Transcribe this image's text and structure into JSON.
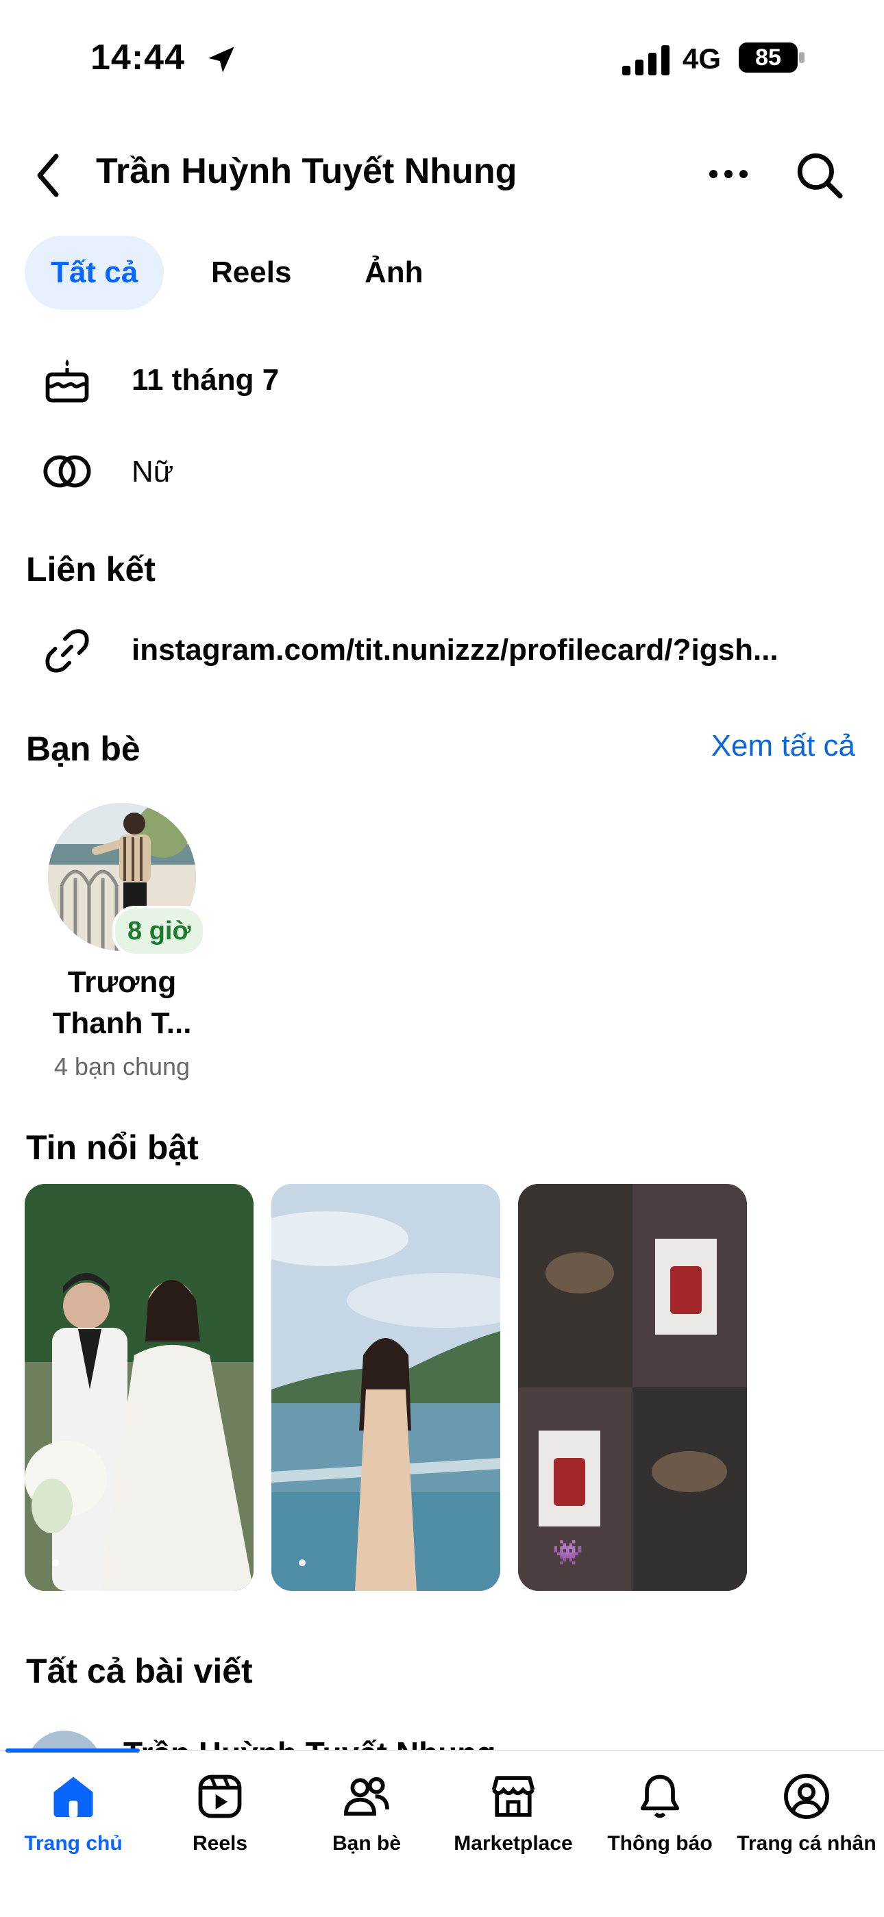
{
  "status": {
    "time": "14:44",
    "network": "4G",
    "battery": "85"
  },
  "header": {
    "title": "Trần Huỳnh Tuyết Nhung",
    "back_icon": "chevron-left-icon",
    "more_icon": "ellipsis-icon",
    "search_icon": "search-icon"
  },
  "tabs": [
    {
      "label": "Tất cả",
      "active": true
    },
    {
      "label": "Reels",
      "active": false
    },
    {
      "label": "Ảnh",
      "active": false
    }
  ],
  "info": {
    "birthday": "11 tháng 7",
    "gender": "Nữ"
  },
  "links": {
    "title": "Liên kết",
    "url": "instagram.com/tit.nunizzz/profilecard/?igsh..."
  },
  "friends": {
    "title": "Bạn bè",
    "see_all": "Xem tất cả",
    "items": [
      {
        "name_line1": "Trương",
        "name_line2": "Thanh T...",
        "mutual": "4 bạn chung",
        "badge": "8 giờ"
      }
    ]
  },
  "highlights": {
    "title": "Tin nổi bật",
    "count": 3
  },
  "posts": {
    "title": "Tất cả bài viết",
    "peek_author": "Trần Huỳnh Tuyết Nhung"
  },
  "nav": [
    {
      "label": "Trang chủ",
      "icon": "home-icon",
      "active": true
    },
    {
      "label": "Reels",
      "icon": "reels-icon",
      "active": false
    },
    {
      "label": "Bạn bè",
      "icon": "friends-icon",
      "active": false
    },
    {
      "label": "Marketplace",
      "icon": "marketplace-icon",
      "active": false
    },
    {
      "label": "Thông báo",
      "icon": "bell-icon",
      "active": false
    },
    {
      "label": "Trang cá nhân",
      "icon": "profile-icon",
      "active": false
    }
  ],
  "colors": {
    "accent": "#0866ff",
    "link": "#0a66d9",
    "tab_bg": "#e7f0fd",
    "badge_text": "#1d7a2e"
  }
}
